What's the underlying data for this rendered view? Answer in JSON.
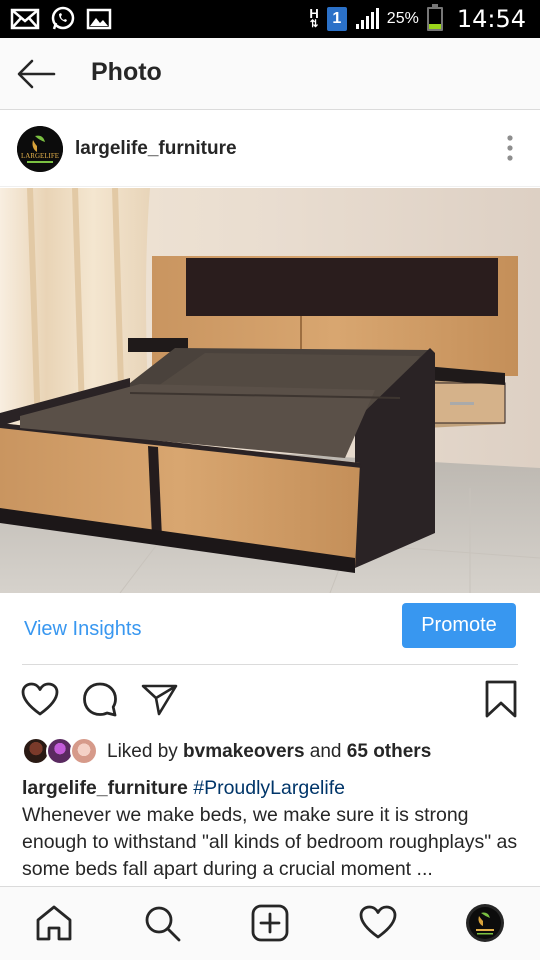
{
  "status_bar": {
    "network": "H",
    "sim": "1",
    "battery_percent": "25%",
    "battery_level": 0.25,
    "time": "14:54",
    "icons": [
      "email-icon",
      "whatsapp-icon",
      "gallery-icon",
      "signal-icon",
      "battery-icon"
    ]
  },
  "header": {
    "title": "Photo"
  },
  "post": {
    "username": "largelife_furniture",
    "avatar_text": "LARGELIFE"
  },
  "insights": {
    "view_label": "View Insights",
    "promote_label": "Promote"
  },
  "likes": {
    "prefix": "Liked by ",
    "user": "bvmakeovers",
    "middle": " and ",
    "count": "65 others"
  },
  "caption": {
    "user": "largelife_furniture",
    "hashtag": "#ProudlyLargelife",
    "text": "Whenever we make beds, we make sure it is strong enough to withstand \"all kinds of bedroom roughplays\"  as some beds fall apart during a crucial moment ... @largelife_furniture"
  },
  "nav": {
    "items": [
      "home",
      "search",
      "add",
      "activity",
      "profile"
    ]
  },
  "colors": {
    "accent": "#3897f0",
    "text": "#262626",
    "hashtag": "#003569"
  }
}
